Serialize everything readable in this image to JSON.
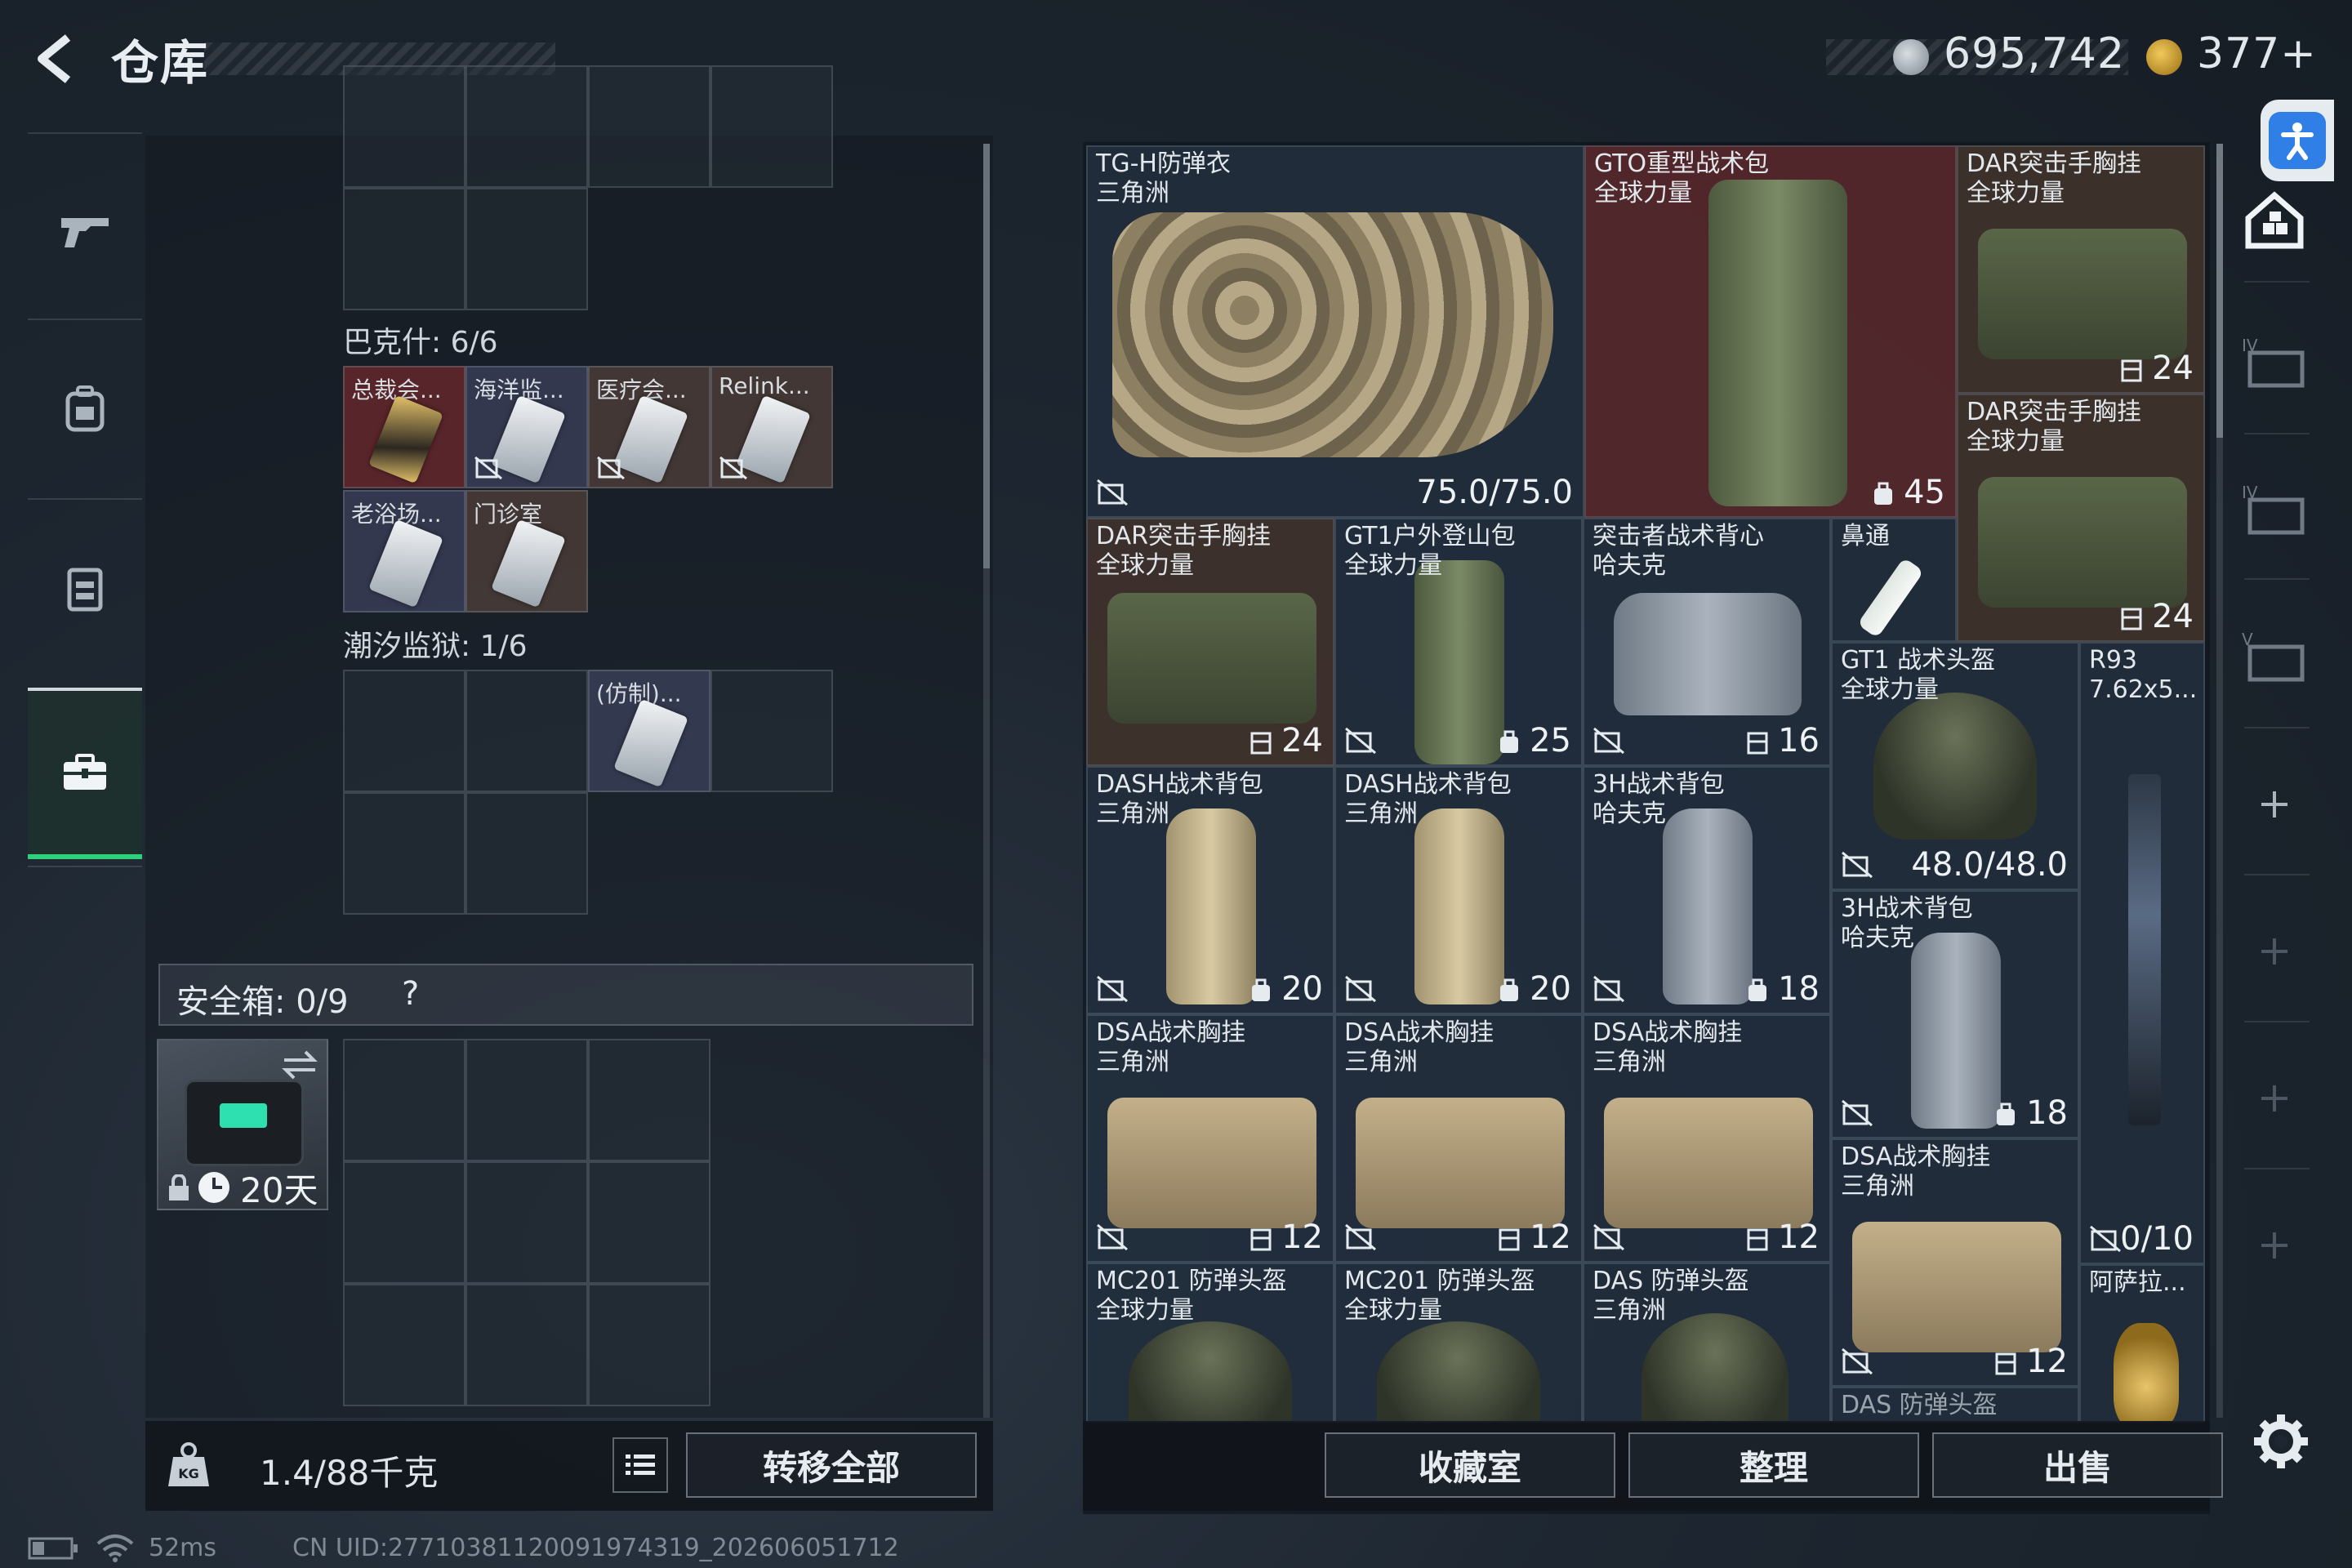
{
  "header": {
    "title": "仓库",
    "currency_silver": "695,742",
    "currency_gold": "377+"
  },
  "left_nav": {
    "items": [
      {
        "icon": "gun-icon"
      },
      {
        "icon": "backpack-icon"
      },
      {
        "icon": "vest-icon"
      },
      {
        "icon": "briefcase-icon",
        "active": true
      }
    ]
  },
  "storage": {
    "bakeshi_label": "巴克什: 6/6",
    "keys": [
      {
        "name": "总裁会...",
        "style": "gold",
        "bound": false
      },
      {
        "name": "海洋监...",
        "style": "silver",
        "bound": true
      },
      {
        "name": "医疗会...",
        "style": "silver",
        "bound": true
      },
      {
        "name": "Relink...",
        "style": "silver",
        "bound": true
      },
      {
        "name": "老浴场...",
        "style": "silver",
        "bound": false
      },
      {
        "name": "门诊室",
        "style": "silver",
        "bound": false
      }
    ],
    "chaoxi_label": "潮汐监狱: 1/6",
    "chaoxi_item": "(仿制)...",
    "safe_label": "安全箱: 0/9",
    "safe_help": "?",
    "safebox_days": "20天"
  },
  "bottom_left": {
    "weight": "1.4/88千克",
    "transfer_all": "转移全部"
  },
  "status": {
    "ping": "52ms",
    "uid": "CN UID:27710381120091974319_202606051712"
  },
  "items": [
    {
      "name": "TG-H防弹衣",
      "sub": "三角洲",
      "value": "75.0/75.0"
    },
    {
      "name": "GTO重型战术包",
      "sub": "全球力量",
      "value": "45"
    },
    {
      "name": "DAR突击手胸挂",
      "sub": "全球力量",
      "value": "24"
    },
    {
      "name": "DAR突击手胸挂",
      "sub": "全球力量",
      "value": "24"
    },
    {
      "name": "DAR突击手胸挂",
      "sub": "全球力量",
      "value": "24"
    },
    {
      "name": "GT1户外登山包",
      "sub": "全球力量",
      "value": "25"
    },
    {
      "name": "突击者战术背心",
      "sub": "哈夫克",
      "value": "16"
    },
    {
      "name": "鼻通",
      "sub": "",
      "value": ""
    },
    {
      "name": "GT1 战术头盔",
      "sub": "全球力量",
      "value": "48.0/48.0"
    },
    {
      "name": "R93",
      "sub": "7.62x5...",
      "value": "0/10"
    },
    {
      "name": "DASH战术背包",
      "sub": "三角洲",
      "value": "20"
    },
    {
      "name": "DASH战术背包",
      "sub": "三角洲",
      "value": "20"
    },
    {
      "name": "3H战术背包",
      "sub": "哈夫克",
      "value": "18"
    },
    {
      "name": "3H战术背包",
      "sub": "哈夫克",
      "value": "18"
    },
    {
      "name": "DSA战术胸挂",
      "sub": "三角洲",
      "value": "12"
    },
    {
      "name": "DSA战术胸挂",
      "sub": "三角洲",
      "value": "12"
    },
    {
      "name": "DSA战术胸挂",
      "sub": "三角洲",
      "value": "12"
    },
    {
      "name": "DSA战术胸挂",
      "sub": "三角洲",
      "value": "12"
    },
    {
      "name": "MC201 防弹头盔",
      "sub": "全球力量",
      "value": ""
    },
    {
      "name": "MC201 防弹头盔",
      "sub": "全球力量",
      "value": ""
    },
    {
      "name": "DAS 防弹头盔",
      "sub": "三角洲",
      "value": ""
    },
    {
      "name": "阿萨拉...",
      "sub": "",
      "value": ""
    },
    {
      "name": "DAS 防弹头盔",
      "sub": "",
      "value": ""
    }
  ],
  "bottom_right": {
    "collection": "收藏室",
    "organize": "整理",
    "sell": "出售"
  }
}
